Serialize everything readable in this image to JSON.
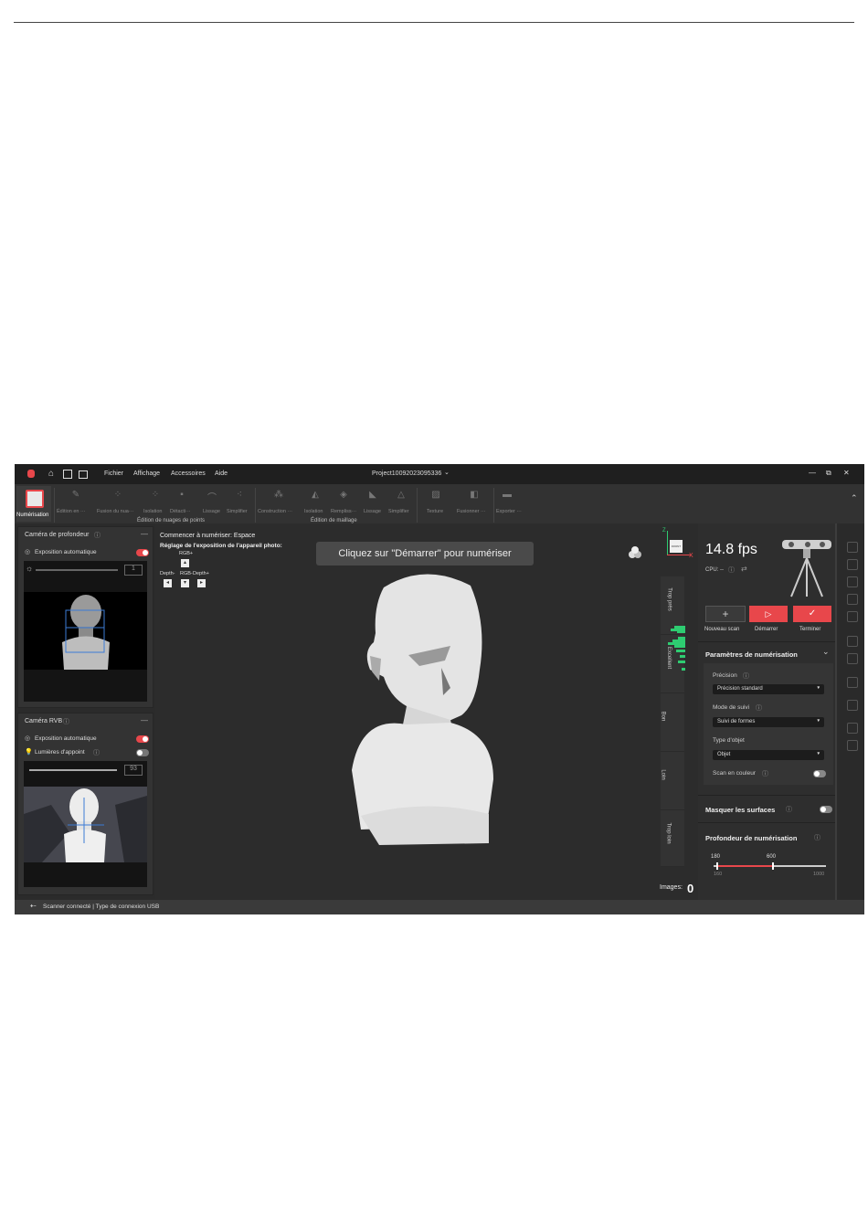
{
  "window": {
    "title": "Project10092023095336",
    "controls": [
      "—",
      "⧉",
      "✕"
    ]
  },
  "menu": [
    "Fichier",
    "Affichage",
    "Accessoires",
    "Aide"
  ],
  "ribbon": {
    "scan_label": "Numérisation",
    "items": [
      "Édition en ···",
      "Fusion du nua···",
      "Isolation",
      "Détacti···",
      "Lissage",
      "Simplifier",
      "Construction ···",
      "Isolation",
      "Rempliss···",
      "Lissage",
      "Simplifier",
      "Texture",
      "Fusionner ···",
      "Exporter ···"
    ],
    "groups": [
      "Édition de nuages de points",
      "Édition de maillage"
    ]
  },
  "depth_camera": {
    "title": "Caméra de profondeur",
    "auto_exposure": "Exposition automatique",
    "slider_value": "1"
  },
  "rgb_camera": {
    "title": "Caméra RVB",
    "auto_exposure": "Exposition automatique",
    "lights": "Lumières d'appoint",
    "slider_value": "93"
  },
  "viewport": {
    "start_text": "Commencer à numériser: Espace",
    "exposure_text": "Réglage de l'exposition de l'appareil photo:",
    "keys": {
      "rgb_plus": "RGB+",
      "depth_minus": "Depth-",
      "rgb_minus": "RGB-",
      "depth_plus": "Depth+"
    },
    "banner": "Cliquez sur \"Démarrer\" pour numériser",
    "axes": {
      "z": "Z",
      "x": "X"
    },
    "cube_label": "FRONT"
  },
  "quality": [
    "Trop près",
    "Excellent",
    "Bon",
    "Loin",
    "Trop loin"
  ],
  "images": {
    "label": "Images:",
    "value": "0"
  },
  "right_panel": {
    "fps": "14.8 fps",
    "cpu": "CPU: --",
    "buttons": {
      "new": "Nouveau scan",
      "start": "Démarrer",
      "finish": "Terminer"
    },
    "params_title": "Paramètres de numérisation",
    "precision_label": "Précision",
    "precision_value": "Précision standard",
    "tracking_label": "Mode de suivi",
    "tracking_value": "Suivi de formes",
    "object_label": "Type d'objet",
    "object_value": "Objet",
    "color_scan": "Scan en couleur",
    "mask": "Masquer les surfaces",
    "depth_title": "Profondeur de numérisation",
    "depth_values": {
      "low": "180",
      "high": "600",
      "min": "160",
      "max": "1000"
    }
  },
  "statusbar": "Scanner connecté | Type de connexion USB",
  "colors": {
    "accent": "#e8474b",
    "quality": "#2ecc71"
  }
}
